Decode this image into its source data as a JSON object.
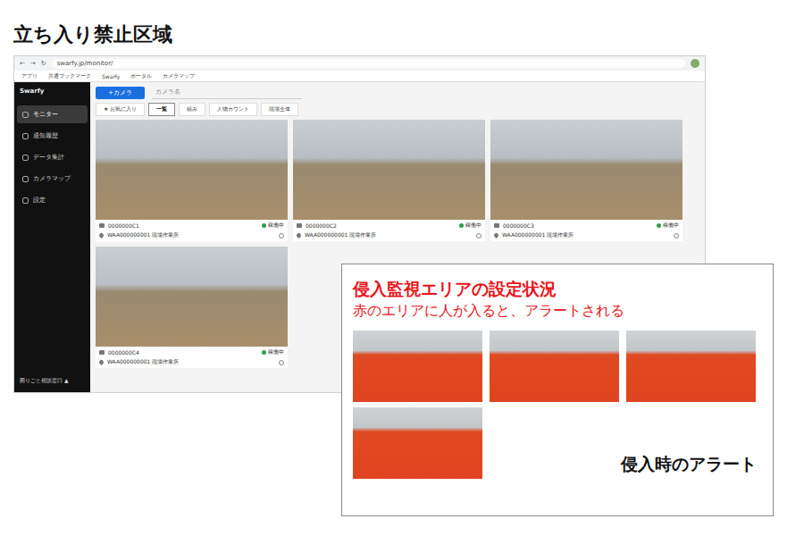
{
  "slide_title": "立ち入り禁止区域",
  "browser": {
    "nav": [
      "←",
      "→",
      "↻"
    ],
    "url": "swarfy.jp/monitor/",
    "bookmarks": [
      "アプリ",
      "共通ブックマーク",
      "Swarfy",
      "ポータル",
      "カメラマップ"
    ]
  },
  "app": {
    "logo": "Swarfy",
    "sidebar": [
      {
        "label": "モニター",
        "selected": true
      },
      {
        "label": "通知履歴",
        "selected": false
      },
      {
        "label": "データ集計",
        "selected": false
      },
      {
        "label": "カメラマップ",
        "selected": false
      },
      {
        "label": "設定",
        "selected": false
      }
    ],
    "footer": "困りごと相談窓口 ▲",
    "add_button": "+カメラ",
    "search_placeholder": "カメラ名",
    "tabs": [
      {
        "label": "★ お気に入り",
        "selected": false
      },
      {
        "label": "一覧",
        "selected": true
      },
      {
        "label": "組み",
        "selected": false
      },
      {
        "label": "人物カウント",
        "selected": false
      },
      {
        "label": "現場全体",
        "selected": false
      }
    ],
    "cameras": [
      {
        "id": "0000000C1",
        "site": "WAA000000001 現場作業所",
        "status": "稼働中",
        "color": "#2e9e4f"
      },
      {
        "id": "0000000C2",
        "site": "WAA000000001 現場作業所",
        "status": "稼働中",
        "color": "#2e9e4f"
      },
      {
        "id": "0000000C3",
        "site": "WAA000000001 現場作業所",
        "status": "稼働中",
        "color": "#2e9e4f"
      },
      {
        "id": "0000000C4",
        "site": "WAA000000001 現場作業所",
        "status": "稼働中",
        "color": "#2e9e4f"
      }
    ]
  },
  "overlay": {
    "title": "侵入監視エリアの設定状況",
    "subtitle": "赤のエリアに人が入ると、アラートされる",
    "thumbnails": [
      {
        "alert_zone": true
      },
      {
        "alert_zone": true
      },
      {
        "alert_zone": true
      },
      {
        "alert_zone": true
      }
    ],
    "caption": "侵入時のアラート"
  }
}
